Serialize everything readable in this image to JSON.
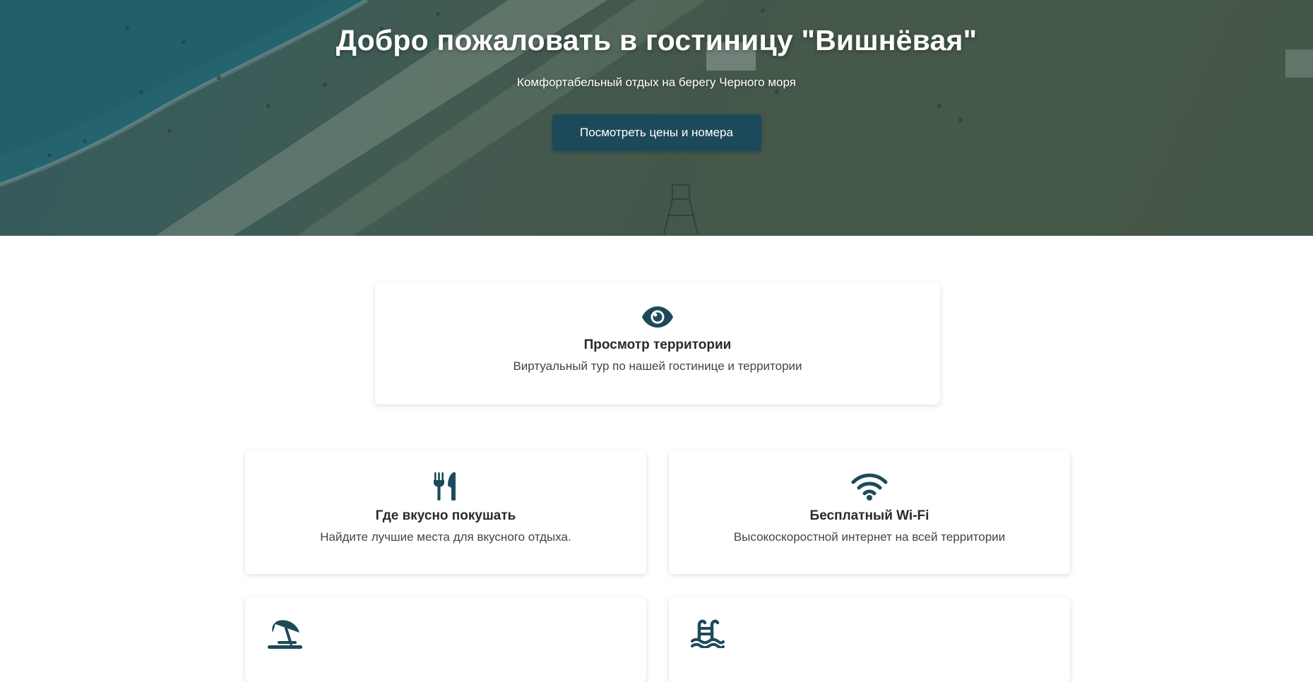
{
  "hero": {
    "title": "Добро пожаловать в гостиницу \"Вишнёвая\"",
    "subtitle": "Комфортабельный отдых на берегу Черного моря",
    "button_label": "Посмотреть цены и номера"
  },
  "features": {
    "territory": {
      "icon": "eye-icon",
      "title": "Просмотр территории",
      "description": "Виртуальный тур по нашей гостинице и территории"
    },
    "food": {
      "icon": "utensils-icon",
      "title": "Где вкусно покушать",
      "description": "Найдите лучшие места для вкусного отдыха."
    },
    "wifi": {
      "icon": "wifi-icon",
      "title": "Бесплатный Wi-Fi",
      "description": "Высокоскоростной интернет на всей территории"
    },
    "beach": {
      "icon": "beach-umbrella-icon"
    },
    "pool": {
      "icon": "swimming-pool-icon"
    }
  },
  "colors": {
    "accent": "#1d4a5a",
    "text": "#2a2a2a",
    "muted_text": "#444444",
    "hero_overlay": "#1a3e46"
  }
}
